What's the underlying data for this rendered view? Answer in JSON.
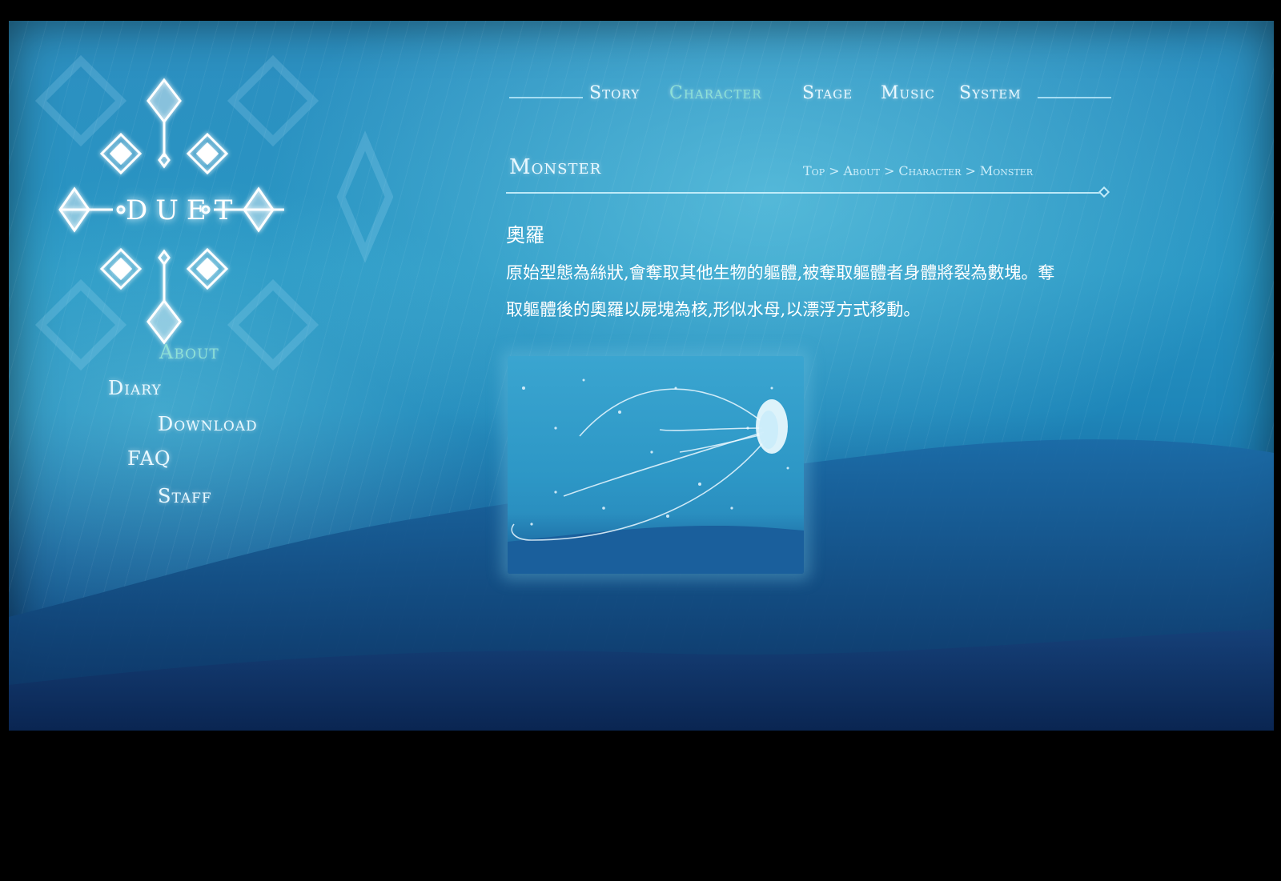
{
  "logo": {
    "text": "DUET"
  },
  "sidebar": {
    "items": [
      {
        "label": "About",
        "active": true
      },
      {
        "label": "Diary",
        "active": false
      },
      {
        "label": "Download",
        "active": false
      },
      {
        "label": "FAQ",
        "active": false
      },
      {
        "label": "Staff",
        "active": false
      }
    ]
  },
  "nav": {
    "items": [
      {
        "label": "Story",
        "active": false
      },
      {
        "label": "Character",
        "active": true
      },
      {
        "label": "Stage",
        "active": false
      },
      {
        "label": "Music",
        "active": false
      },
      {
        "label": "System",
        "active": false
      }
    ]
  },
  "header": {
    "title": "Monster",
    "breadcrumb": [
      "Top",
      "About",
      "Character",
      "Monster"
    ],
    "separator": ">"
  },
  "content": {
    "name": "奧羅",
    "description_line1": "原始型態為絲狀,會奪取其他生物的軀體,被奪取軀體者身體將裂為數塊。奪",
    "description_line2": "取軀體後的奧羅以屍塊為核,形似水母,以漂浮方式移動。"
  },
  "colors": {
    "accent": "#8ee0d6",
    "text": "#e9f8ff",
    "background_top": "#2d8fc0",
    "background_bottom": "#0f3c70"
  }
}
